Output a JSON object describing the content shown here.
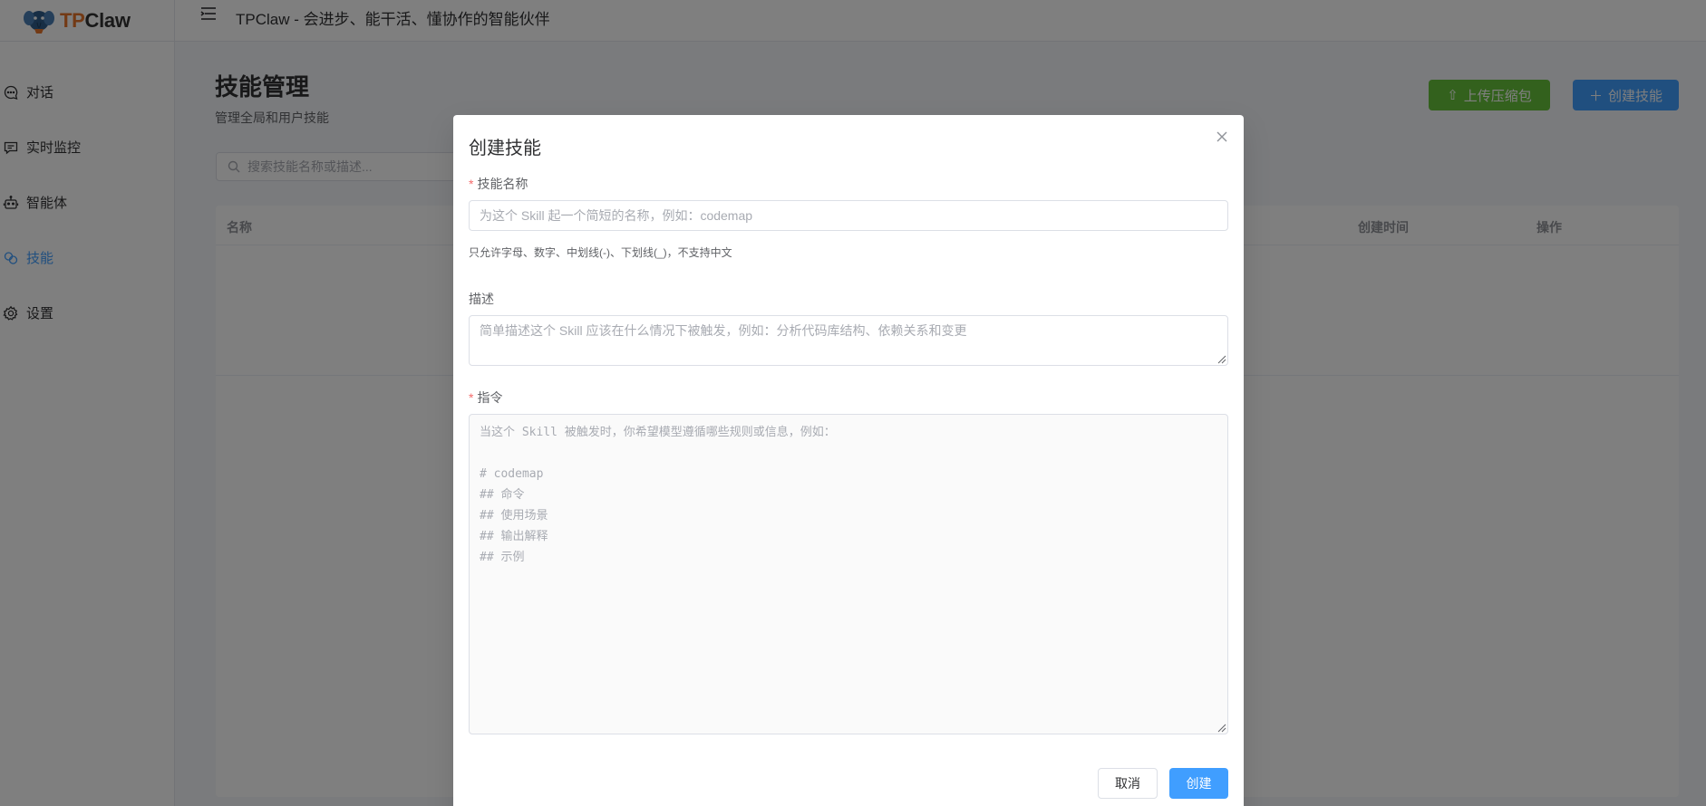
{
  "app": {
    "logo_tp": "TP",
    "logo_claw": "Claw",
    "header_title": "TPClaw - 会进步、能干活、懂协作的智能伙伴"
  },
  "sidebar": {
    "items": [
      {
        "label": "对话",
        "icon": "chat-icon",
        "active": false
      },
      {
        "label": "实时监控",
        "icon": "monitor-icon",
        "active": false
      },
      {
        "label": "智能体",
        "icon": "robot-icon",
        "active": false
      },
      {
        "label": "技能",
        "icon": "skill-icon",
        "active": true
      },
      {
        "label": "设置",
        "icon": "gear-icon",
        "active": false
      }
    ]
  },
  "page": {
    "title": "技能管理",
    "subtitle": "管理全局和用户技能",
    "upload_button": "上传压缩包",
    "create_button": "创建技能",
    "search_placeholder": "搜索技能名称或描述...",
    "table_headers": [
      "名称",
      "创建时间",
      "操作"
    ]
  },
  "dialog": {
    "title": "创建技能",
    "name_label": "技能名称",
    "name_placeholder": "为这个 Skill 起一个简短的名称，例如：codemap",
    "name_hint": "只允许字母、数字、中划线(-)、下划线(_)，不支持中文",
    "desc_label": "描述",
    "desc_placeholder": "简单描述这个 Skill 应该在什么情况下被触发，例如：分析代码库结构、依赖关系和变更",
    "instr_label": "指令",
    "instr_placeholder": "当这个 Skill 被触发时，你希望模型遵循哪些规则或信息，例如：\n\n# codemap\n## 命令\n## 使用场景\n## 输出解释\n## 示例",
    "cancel_button": "取消",
    "create_button": "创建"
  },
  "colors": {
    "primary": "#409eff",
    "success": "#67c23a",
    "required": "#f56c6c",
    "logo_orange": "#e6742b"
  }
}
